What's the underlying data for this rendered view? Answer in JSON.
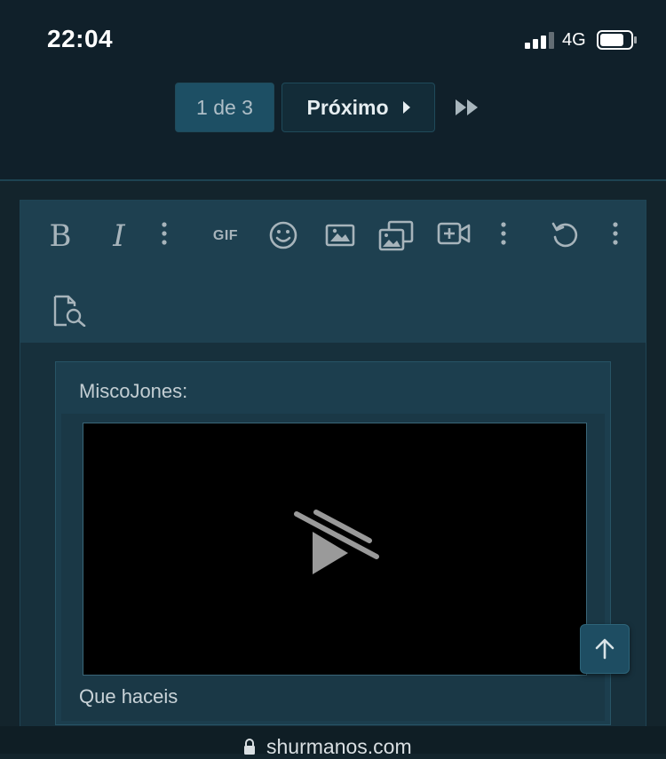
{
  "status_bar": {
    "time": "22:04",
    "network": "4G"
  },
  "pagination": {
    "current": "1 de 3",
    "next_label": "Próximo"
  },
  "toolbar": {
    "bold": "B",
    "italic": "I",
    "gif": "GIF"
  },
  "quote": {
    "author": "MiscoJones:",
    "text": "Que haceis"
  },
  "browser": {
    "url": "shurmanos.com"
  }
}
